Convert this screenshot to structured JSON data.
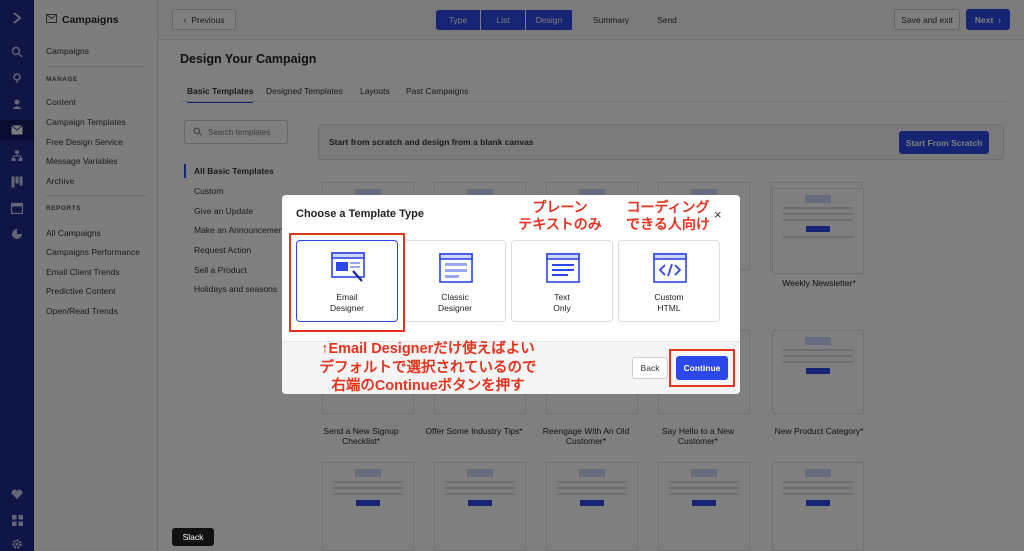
{
  "rail": {
    "icons": [
      "logo-chevron-icon",
      "search-icon",
      "location-icon",
      "user-icon",
      "mail-icon",
      "org-chart-icon",
      "kanban-icon",
      "calendar-icon",
      "pie-chart-icon",
      "heart-icon",
      "apps-icon",
      "settings-icon"
    ]
  },
  "sidebar": {
    "title": "Campaigns",
    "top_items": [
      "Campaigns"
    ],
    "manage_label": "MANAGE",
    "manage_items": [
      "Content",
      "Campaign Templates",
      "Free Design Service",
      "Message Variables",
      "Archive"
    ],
    "reports_label": "REPORTS",
    "reports_items": [
      "All Campaigns",
      "Campaigns Performance",
      "Email Client Trends",
      "Predictive Content",
      "Open/Read Trends"
    ]
  },
  "topbar": {
    "previous": "Previous",
    "steps": [
      "Type",
      "List",
      "Design",
      "Summary",
      "Send"
    ],
    "save_exit": "Save and exit",
    "next": "Next"
  },
  "page": {
    "title": "Design Your Campaign",
    "tabs": [
      "Basic Templates",
      "Designed Templates",
      "Layouts",
      "Past Campaigns"
    ],
    "search_placeholder": "Search templates",
    "categories": [
      "All Basic Templates",
      "Custom",
      "Give an Update",
      "Make an Announcement",
      "Request Action",
      "Sell a Product",
      "Holidays and seasons"
    ],
    "scratch_text": "Start from scratch and design from a blank canvas",
    "scratch_button": "Start From Scratch",
    "tile_labels": [
      "Weekly Newsletter*",
      "Send a New Signup Checklist*",
      "Offer Some Industry Tips*",
      "Reengage With An Old Customer*",
      "Say Hello to a New Customer*",
      "New Product Category*"
    ]
  },
  "modal": {
    "title": "Choose a Template Type",
    "close": "×",
    "options": [
      {
        "line1": "Email",
        "line2": "Designer"
      },
      {
        "line1": "Classic",
        "line2": "Designer"
      },
      {
        "line1": "Text",
        "line2": "Only"
      },
      {
        "line1": "Custom",
        "line2": "HTML"
      }
    ],
    "back": "Back",
    "continue": "Continue"
  },
  "annotations": {
    "plain_text": [
      "プレーン",
      "テキストのみ"
    ],
    "coding": [
      "コーディング",
      "できる人向け"
    ],
    "instruction": [
      "↑Email Designerだけ使えばよい",
      "デフォルトで選択されているので",
      "右端のContinueボタンを押す"
    ]
  },
  "tooltip": "Slack",
  "colors": {
    "accent": "#2d48e8",
    "rail": "#1e2d8a",
    "annotation": "#e4331e"
  }
}
